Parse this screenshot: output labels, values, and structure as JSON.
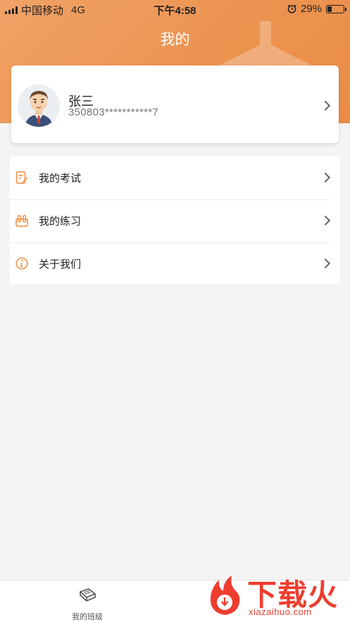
{
  "status_bar": {
    "carrier": "中国移动",
    "network": "4G",
    "time": "下午4:58",
    "battery_percent": "29%",
    "battery_level": 0.29
  },
  "header": {
    "title": "我的"
  },
  "profile": {
    "name": "张三",
    "id_masked": "350803***********7"
  },
  "menu": {
    "items": [
      {
        "label": "我的考试",
        "icon": "exam-icon"
      },
      {
        "label": "我的练习",
        "icon": "practice-icon"
      },
      {
        "label": "关于我们",
        "icon": "info-icon"
      }
    ]
  },
  "tabbar": {
    "items": [
      {
        "label": "我的班级",
        "icon": "book-icon"
      }
    ]
  },
  "watermark": {
    "text": "下载火",
    "url": "xiazaihuo.com"
  },
  "colors": {
    "header_orange": "#ec9350",
    "icon_orange": "#ef8a3c",
    "watermark_red": "#ee3d2f"
  }
}
